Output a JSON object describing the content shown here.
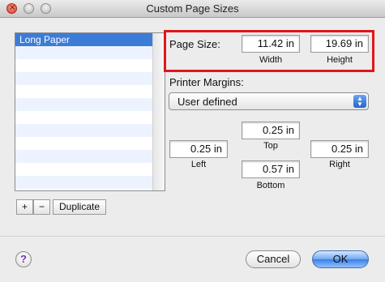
{
  "window": {
    "title": "Custom Page Sizes",
    "close_glyph": "×"
  },
  "sidebar": {
    "items": [
      {
        "label": "Long Paper",
        "selected": true
      }
    ],
    "add_label": "+",
    "remove_label": "−",
    "duplicate_label": "Duplicate"
  },
  "page_size": {
    "label": "Page Size:",
    "width_value": "11.42 in",
    "height_value": "19.69 in",
    "width_caption": "Width",
    "height_caption": "Height"
  },
  "margins": {
    "label": "Printer Margins:",
    "preset": "User defined",
    "top_value": "0.25 in",
    "left_value": "0.25 in",
    "right_value": "0.25 in",
    "bottom_value": "0.57 in",
    "top_caption": "Top",
    "left_caption": "Left",
    "right_caption": "Right",
    "bottom_caption": "Bottom"
  },
  "footer": {
    "help_label": "?",
    "cancel_label": "Cancel",
    "ok_label": "OK"
  },
  "colors": {
    "highlight": "#e0171c",
    "selection": "#3c7cd7",
    "default_button": "#3c7fe5"
  }
}
